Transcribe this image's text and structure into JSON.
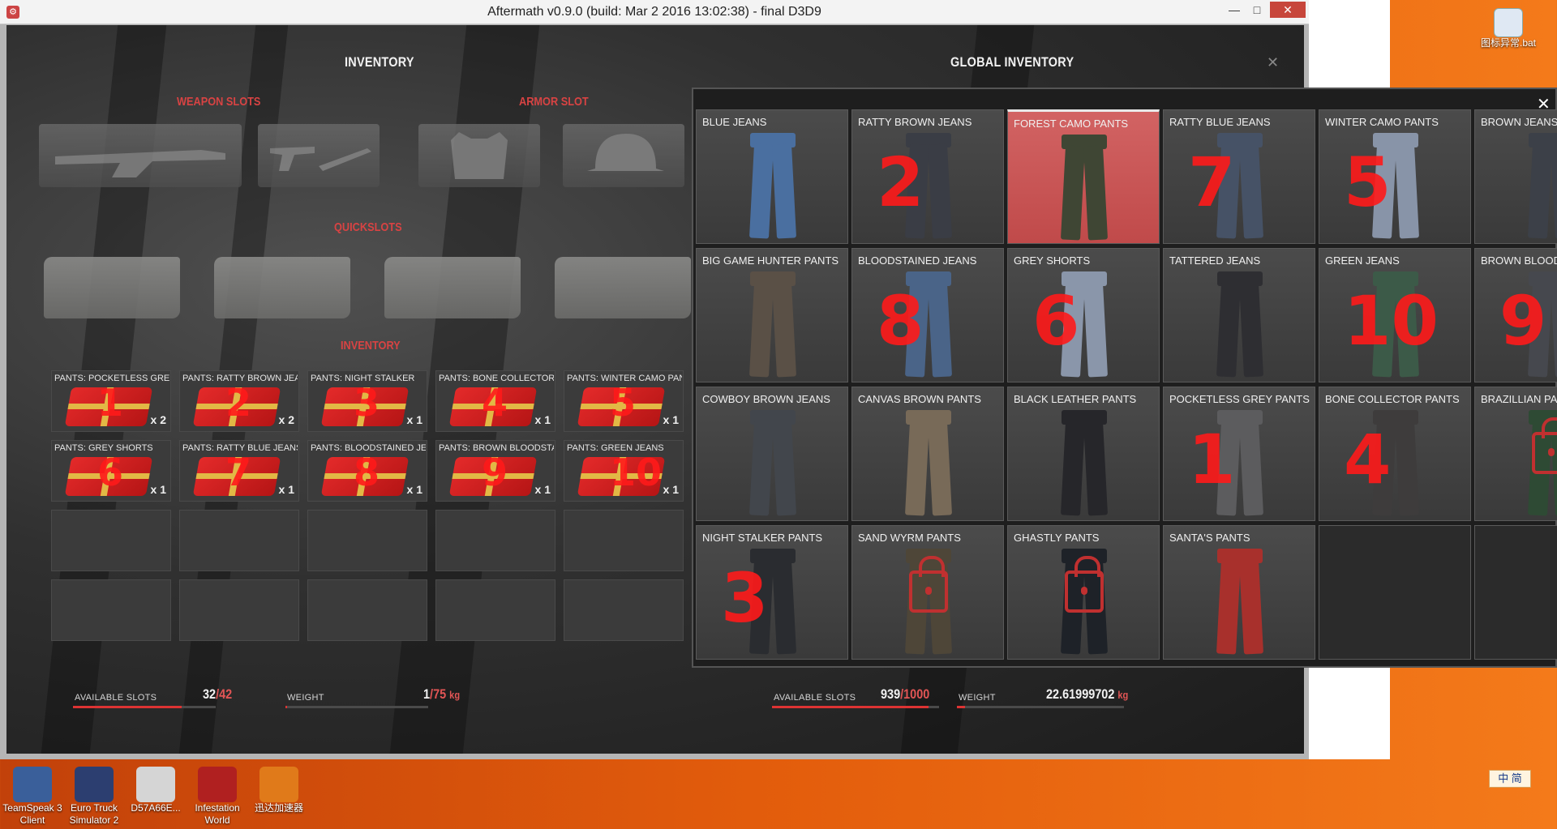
{
  "window": {
    "title": "Aftermath v0.9.0  (build: Mar  2 2016 13:02:38) - final D3D9",
    "minimize": "—",
    "maximize": "□",
    "close": "✕"
  },
  "headers": {
    "inventory": "INVENTORY",
    "global_inventory": "GLOBAL INVENTORY",
    "weapon_slots": "WEAPON SLOTS",
    "armor_slot": "ARMOR SLOT",
    "quickslots": "QUICKSLOTS",
    "inventory_section": "INVENTORY",
    "panel_close": "✕",
    "global_close": "✕"
  },
  "inventory_items": [
    {
      "label": "PANTS: POCKETLESS GREY P",
      "count": "x 2",
      "note": "1"
    },
    {
      "label": "PANTS: RATTY BROWN JEAN",
      "count": "x 2",
      "note": "2"
    },
    {
      "label": "PANTS: NIGHT STALKER",
      "count": "x 1",
      "note": "3"
    },
    {
      "label": "PANTS: BONE COLLECTOR",
      "count": "x 1",
      "note": "4"
    },
    {
      "label": "PANTS: WINTER CAMO PAN",
      "count": "x 1",
      "note": "5"
    },
    {
      "label": "PANTS: GREY SHORTS",
      "count": "x 1",
      "note": "6"
    },
    {
      "label": "PANTS: RATTY BLUE JEANS",
      "count": "x 1",
      "note": "7"
    },
    {
      "label": "PANTS: BLOODSTAINED JEAI",
      "count": "x 1",
      "note": "8"
    },
    {
      "label": "PANTS: BROWN BLOODSTAI",
      "count": "x 1",
      "note": "9"
    },
    {
      "label": "PANTS: GREEN JEANS",
      "count": "x 1",
      "note": "10"
    }
  ],
  "global_items": [
    {
      "label": "BLUE JEANS",
      "color": "#4a6fa0",
      "note": ""
    },
    {
      "label": "RATTY BROWN JEANS",
      "color": "#3a3d45",
      "note": "2"
    },
    {
      "label": "FOREST CAMO PANTS",
      "color": "#3f4634",
      "note": "",
      "selected": true
    },
    {
      "label": "RATTY BLUE JEANS",
      "color": "#465266",
      "note": "7"
    },
    {
      "label": "WINTER CAMO PANTS",
      "color": "#8894a8",
      "note": "5"
    },
    {
      "label": "BROWN JEANS",
      "color": "#3c4048",
      "note": ""
    },
    {
      "label": "BIG GAME HUNTER PANTS",
      "color": "#5a5046",
      "note": ""
    },
    {
      "label": "BLOODSTAINED JEANS",
      "color": "#4a6488",
      "note": "8"
    },
    {
      "label": "GREY SHORTS",
      "color": "#8a96aa",
      "note": "6"
    },
    {
      "label": "TATTERED JEANS",
      "color": "#2e2e32",
      "note": ""
    },
    {
      "label": "GREEN JEANS",
      "color": "#3c5a48",
      "note": "10"
    },
    {
      "label": "BROWN BLOOD",
      "color": "#46484e",
      "note": "9"
    },
    {
      "label": "COWBOY BROWN JEANS",
      "color": "#42464c",
      "note": ""
    },
    {
      "label": "CANVAS BROWN PANTS",
      "color": "#786a58",
      "note": ""
    },
    {
      "label": "BLACK LEATHER PANTS",
      "color": "#26262a",
      "note": ""
    },
    {
      "label": "POCKETLESS GREY PANTS",
      "color": "#5c5c5e",
      "note": "1"
    },
    {
      "label": "BONE COLLECTOR PANTS",
      "color": "#3e3c3c",
      "note": "4"
    },
    {
      "label": "BRAZILLIAN PAN",
      "color": "#2e4a34",
      "note": "",
      "locked": true
    },
    {
      "label": "NIGHT STALKER PANTS",
      "color": "#2a2c30",
      "note": "3"
    },
    {
      "label": "SAND WYRM PANTS",
      "color": "#4e4638",
      "note": "",
      "locked": true
    },
    {
      "label": "GHASTLY PANTS",
      "color": "#1e2228",
      "note": "",
      "locked": true
    },
    {
      "label": "SANTA'S PANTS",
      "color": "#a8302c",
      "note": ""
    }
  ],
  "stats": {
    "left": {
      "slots_label": "AVAILABLE SLOTS",
      "slots_used": "32",
      "slots_total": "/42",
      "weight_label": "WEIGHT",
      "weight_val": "1",
      "weight_max": "/75",
      "weight_unit": "kg",
      "slots_fraction": 0.76,
      "weight_fraction": 0.013
    },
    "right": {
      "slots_label": "AVAILABLE SLOTS",
      "slots_used": "939",
      "slots_total": "/1000",
      "weight_label": "WEIGHT",
      "weight_val": "22.61999702",
      "weight_unit": "kg",
      "slots_fraction": 0.939,
      "weight_fraction": 0.05
    }
  },
  "desktop": {
    "top_right_icon": "图标异常.bat",
    "icons": [
      "TeamSpeak 3 Client",
      "Euro Truck Simulator 2",
      "D57A66E...",
      "Infestation World",
      "迅达加速器"
    ],
    "ime": "中 简"
  }
}
